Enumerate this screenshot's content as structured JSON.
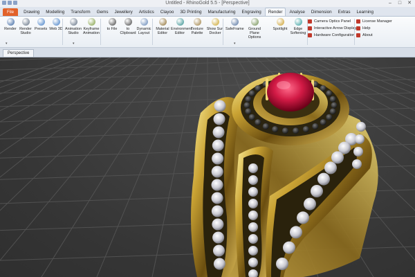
{
  "window": {
    "title": "Untitled - RhinoGold 5.5 - [Perspective]"
  },
  "tabs": [
    "File",
    "Drawing",
    "Modelling",
    "Transform",
    "Gems",
    "Jewellery",
    "Artistics",
    "Clayoo",
    "3D Printing",
    "Manufacturing",
    "Engraving",
    "Render",
    "Analyse",
    "Dimension",
    "Extras",
    "Learning"
  ],
  "active_tab": "Render",
  "ribbon": {
    "buttons": [
      {
        "label": "Render",
        "icon": "render-sphere-icon",
        "color": "#2f5d9c"
      },
      {
        "label": "Render Studio",
        "icon": "render-studio-icon",
        "color": "#5a6a7e"
      },
      {
        "label": "Presets",
        "icon": "presets-icon",
        "color": "#3a78c4"
      },
      {
        "label": "Web 3D",
        "icon": "web-3d-icon",
        "color": "#3a78c4"
      },
      {
        "label": "Animation Studio",
        "icon": "animation-studio-icon",
        "color": "#5a6a7e"
      },
      {
        "label": "Keyframe Animation",
        "icon": "keyframe-animation-icon",
        "color": "#7a9a3a"
      },
      {
        "label": "to File",
        "icon": "camera-to-file-icon",
        "color": "#3d3d3d"
      },
      {
        "label": "to Clipboard",
        "icon": "camera-to-clipboard-icon",
        "color": "#3d3d3d"
      },
      {
        "label": "Dynamic Layout",
        "icon": "dynamic-layout-icon",
        "color": "#5a7fb2"
      },
      {
        "label": "Material Editor",
        "icon": "material-editor-icon",
        "color": "#8a6a2a"
      },
      {
        "label": "Environment Editor",
        "icon": "environment-editor-icon",
        "color": "#2a8a8a"
      },
      {
        "label": "Texture Palette",
        "icon": "texture-palette-icon",
        "color": "#9a7a3a"
      },
      {
        "label": "Show Sun Docker",
        "icon": "sun-docker-icon",
        "color": "#c8a020"
      },
      {
        "label": "SafeFrame",
        "icon": "safeframe-icon",
        "color": "#4a6a9a"
      },
      {
        "label": "Ground Plane Options",
        "icon": "ground-plane-icon",
        "color": "#6a8a4a"
      },
      {
        "label": "Spotlight",
        "icon": "spotlight-icon",
        "color": "#c89a20"
      },
      {
        "label": "Edge Softening",
        "icon": "edge-softening-icon",
        "color": "#2a9a9a"
      }
    ],
    "list1": [
      "Camera Optics Panel",
      "Interactive Arrow Display",
      "Hardware Configuration"
    ],
    "list2": [
      "License Manager",
      "Help",
      "About"
    ],
    "colors": {
      "list_icon": "#c0392b"
    }
  },
  "viewport": {
    "tab": "Perspective"
  }
}
